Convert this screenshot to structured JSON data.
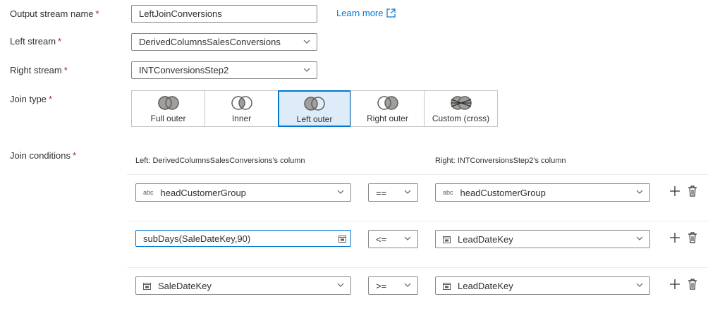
{
  "output_stream": {
    "label": "Output stream name",
    "required": "*",
    "value": "LeftJoinConversions",
    "learn_more": "Learn more"
  },
  "left_stream": {
    "label": "Left stream",
    "required": "*",
    "value": "DerivedColumnsSalesConversions"
  },
  "right_stream": {
    "label": "Right stream",
    "required": "*",
    "value": "INTConversionsStep2"
  },
  "join_type": {
    "label": "Join type",
    "required": "*",
    "selected": "Left outer",
    "options": [
      "Full outer",
      "Inner",
      "Left outer",
      "Right outer",
      "Custom (cross)"
    ]
  },
  "join_conditions": {
    "label": "Join conditions",
    "required": "*",
    "left_header": "Left: DerivedColumnsSalesConversions's column",
    "right_header": "Right: INTConversionsStep2's column",
    "rows": [
      {
        "left": "headCustomerGroup",
        "left_type": "abc",
        "op": "==",
        "right": "headCustomerGroup",
        "right_type": "abc"
      },
      {
        "left": "subDays(SaleDateKey,90)",
        "left_type": "expression",
        "op": "<=",
        "right": "LeadDateKey",
        "right_type": "date"
      },
      {
        "left": "SaleDateKey",
        "left_type": "date",
        "op": ">=",
        "right": "LeadDateKey",
        "right_type": "date"
      }
    ]
  },
  "colors": {
    "accent": "#0078d4",
    "selected_bg": "#deecf9",
    "required": "#a4262c"
  }
}
